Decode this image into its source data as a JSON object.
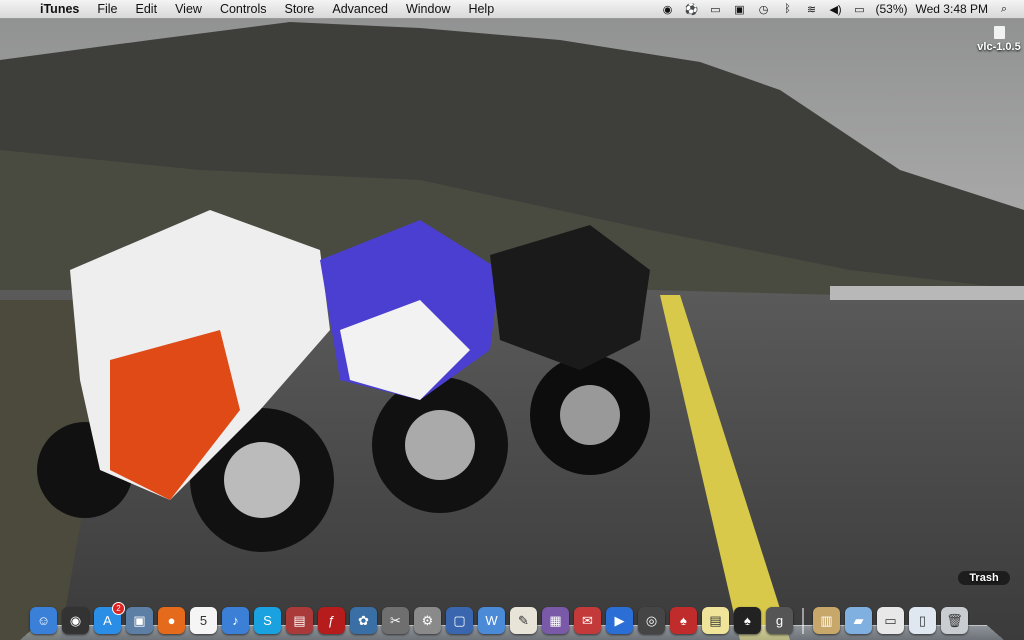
{
  "menubar": {
    "apple_glyph": "",
    "app_name": "iTunes",
    "menus": [
      "File",
      "Edit",
      "View",
      "Controls",
      "Store",
      "Advanced",
      "Window",
      "Help"
    ],
    "battery_percent": "(53%)",
    "clock": "Wed 3:48 PM"
  },
  "desktop": {
    "items": [
      {
        "label": "vlc-1.0.5"
      }
    ],
    "trash_label": "Trash"
  },
  "dock": {
    "apps": [
      {
        "name": "finder-icon",
        "color": "#3a7fd8",
        "glyph": "☺"
      },
      {
        "name": "dashboard-icon",
        "color": "#333333",
        "glyph": "◉"
      },
      {
        "name": "app-store-icon",
        "color": "#2a8ee6",
        "glyph": "A",
        "badge": "2"
      },
      {
        "name": "preview-icon",
        "color": "#5d7fa6",
        "glyph": "▣"
      },
      {
        "name": "firefox-icon",
        "color": "#e56a1c",
        "glyph": "●"
      },
      {
        "name": "calendar-icon",
        "color": "#f5f5f5",
        "glyph": "5"
      },
      {
        "name": "itunes-icon",
        "color": "#3c7fd6",
        "glyph": "♪"
      },
      {
        "name": "skype-icon",
        "color": "#1aa1e0",
        "glyph": "S"
      },
      {
        "name": "photo-booth-icon",
        "color": "#aa3a3a",
        "glyph": "▤"
      },
      {
        "name": "flash-icon",
        "color": "#b71c1c",
        "glyph": "ƒ"
      },
      {
        "name": "iphoto-icon",
        "color": "#3a6fa6",
        "glyph": "✿"
      },
      {
        "name": "grab-icon",
        "color": "#6f6f6f",
        "glyph": "✂"
      },
      {
        "name": "system-preferences-icon",
        "color": "#8a8a8a",
        "glyph": "⚙"
      },
      {
        "name": "virtualbox-icon",
        "color": "#3a66b0",
        "glyph": "▢"
      },
      {
        "name": "word-icon",
        "color": "#4b8ad6",
        "glyph": "W"
      },
      {
        "name": "textedit-icon",
        "color": "#e9e4d8",
        "glyph": "✎"
      },
      {
        "name": "screensaver-icon",
        "color": "#7a5aa8",
        "glyph": "▦"
      },
      {
        "name": "mail-icon",
        "color": "#c43a3a",
        "glyph": "✉"
      },
      {
        "name": "quicktime-icon",
        "color": "#2a6ed6",
        "glyph": "▶"
      },
      {
        "name": "dvd-player-icon",
        "color": "#454545",
        "glyph": "◎"
      },
      {
        "name": "solitaire-icon",
        "color": "#c02b2b",
        "glyph": "♠"
      },
      {
        "name": "stickies-icon",
        "color": "#efe49a",
        "glyph": "▤"
      },
      {
        "name": "spades-icon",
        "color": "#222222",
        "glyph": "♠"
      },
      {
        "name": "google-icon",
        "color": "#555555",
        "glyph": "g"
      }
    ],
    "stacks": [
      {
        "name": "documents-stack-icon",
        "color": "#c8a86a",
        "glyph": "▥"
      },
      {
        "name": "applications-folder-icon",
        "color": "#7fb0e0",
        "glyph": "▰"
      },
      {
        "name": "downloads-stack-icon",
        "color": "#e8e8e8",
        "glyph": "▭"
      },
      {
        "name": "screen-sharing-icon",
        "color": "#dfe8f0",
        "glyph": "▯"
      },
      {
        "name": "trash-icon",
        "color": "#c9cdd2",
        "glyph": "🗑"
      }
    ]
  }
}
